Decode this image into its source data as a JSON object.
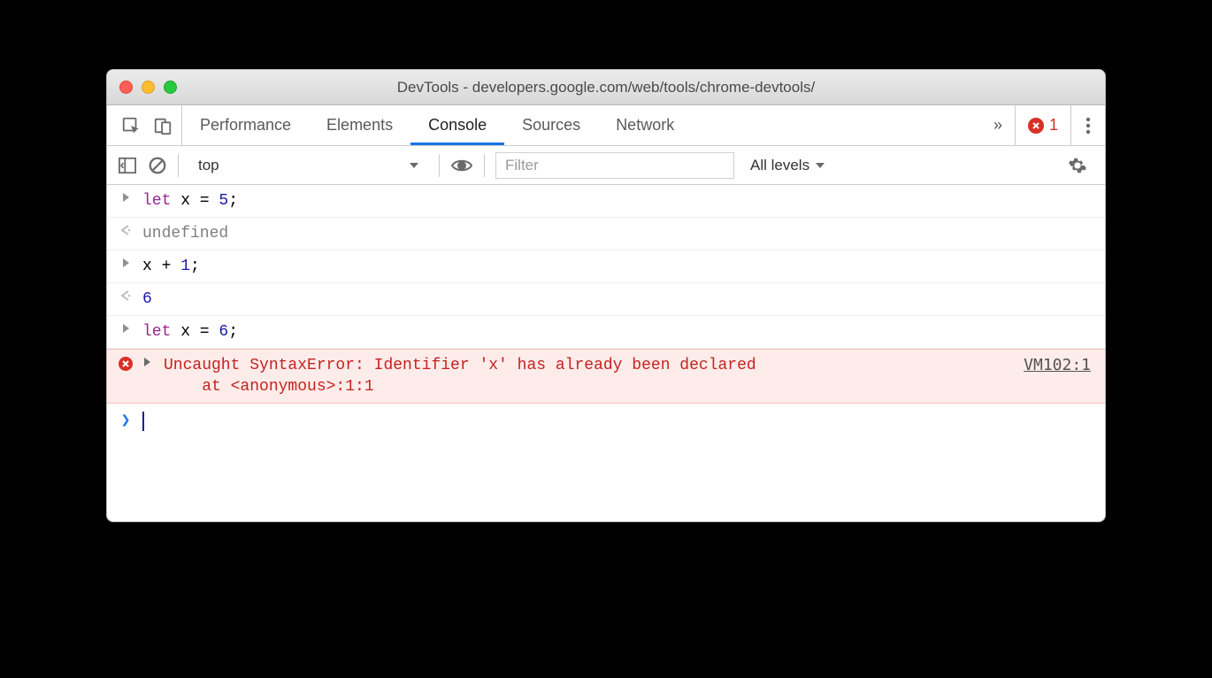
{
  "window": {
    "title": "DevTools - developers.google.com/web/tools/chrome-devtools/"
  },
  "tabs": {
    "items": [
      "Performance",
      "Elements",
      "Console",
      "Sources",
      "Network"
    ],
    "active": "Console",
    "overflow": "»"
  },
  "error_indicator": {
    "count": "1"
  },
  "toolbar": {
    "context": "top",
    "filter_placeholder": "Filter",
    "levels_label": "All levels"
  },
  "console": {
    "lines": [
      {
        "type": "input",
        "segments": [
          [
            "kw",
            "let"
          ],
          [
            "",
            " x = "
          ],
          [
            "num",
            "5"
          ],
          [
            "",
            ";"
          ]
        ]
      },
      {
        "type": "output",
        "text": "undefined"
      },
      {
        "type": "input",
        "segments": [
          [
            "",
            "x + "
          ],
          [
            "num",
            "1"
          ],
          [
            "",
            ";"
          ]
        ]
      },
      {
        "type": "output_num",
        "text": "6"
      },
      {
        "type": "input",
        "segments": [
          [
            "kw",
            "let"
          ],
          [
            "",
            " x = "
          ],
          [
            "num",
            "6"
          ],
          [
            "",
            ";"
          ]
        ]
      }
    ],
    "error": {
      "message": "Uncaught SyntaxError: Identifier 'x' has already been declared",
      "stack": "    at <anonymous>:1:1",
      "source": "VM102:1"
    }
  }
}
